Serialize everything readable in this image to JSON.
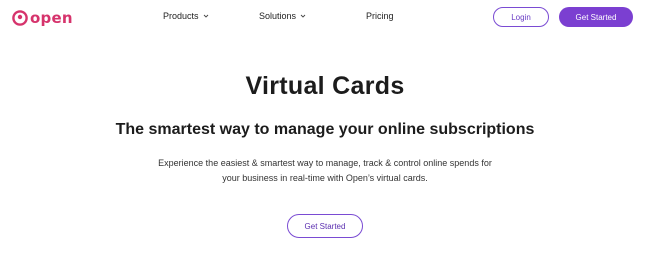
{
  "brand": {
    "name": "open",
    "color": "#d6336c"
  },
  "nav": {
    "items": [
      {
        "label": "Products",
        "has_dropdown": true
      },
      {
        "label": "Solutions",
        "has_dropdown": true
      },
      {
        "label": "Pricing",
        "has_dropdown": false
      }
    ],
    "login_label": "Login",
    "cta_label": "Get Started",
    "accent_color": "#7b3fd1"
  },
  "hero": {
    "title": "Virtual Cards",
    "subtitle": "The smartest way to manage your online subscriptions",
    "description_line1": "Experience the easiest & smartest way to manage, track & control online spends for",
    "description_line2": "your business in real-time with Open’s virtual cards.",
    "cta_label": "Get Started"
  },
  "icons": {
    "logo": "open-logo-icon",
    "dropdown": "chevron-down-icon"
  }
}
